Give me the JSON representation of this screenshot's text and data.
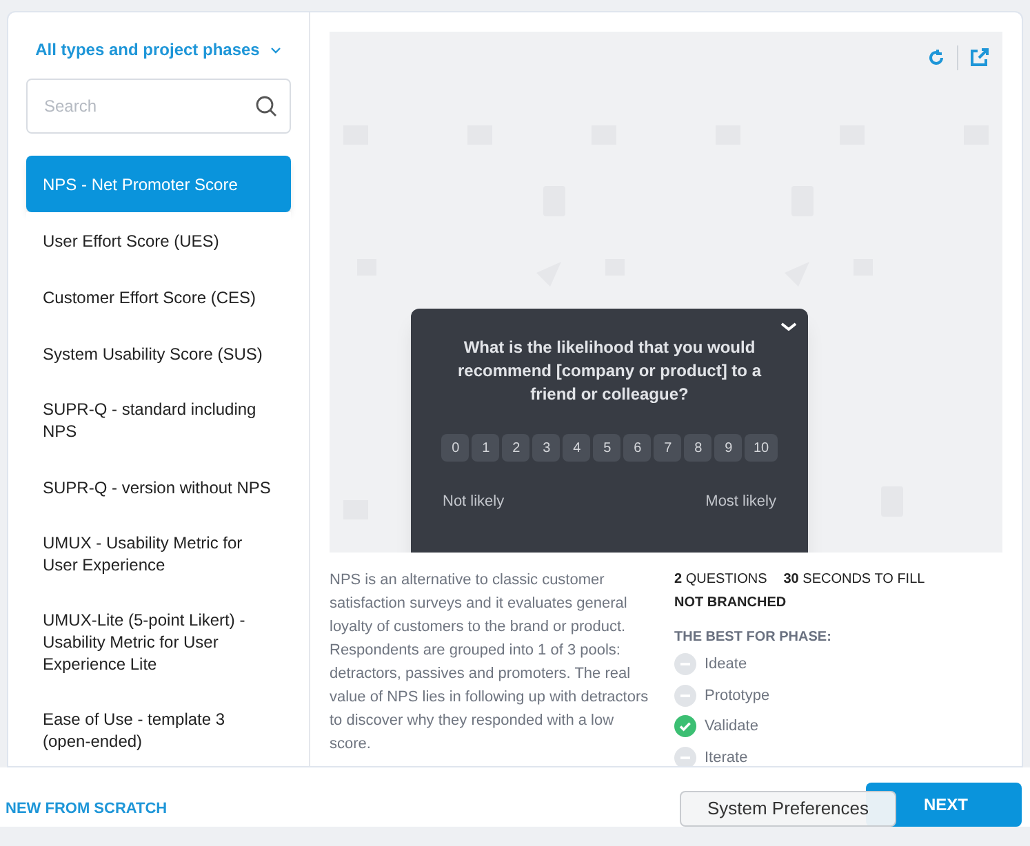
{
  "filter": {
    "label": "All types and project phases"
  },
  "search": {
    "placeholder": "Search"
  },
  "templates": [
    {
      "label": "NPS - Net Promoter Score",
      "selected": true
    },
    {
      "label": "User Effort Score (UES)",
      "selected": false
    },
    {
      "label": "Customer Effort Score (CES)",
      "selected": false
    },
    {
      "label": "System Usability Score (SUS)",
      "selected": false
    },
    {
      "label": "SUPR-Q - standard including NPS",
      "selected": false
    },
    {
      "label": "SUPR-Q - version without NPS",
      "selected": false
    },
    {
      "label": "UMUX - Usability Metric for User Experience",
      "selected": false
    },
    {
      "label": "UMUX-Lite (5-point Likert) - Usability Metric for User Experience Lite",
      "selected": false
    },
    {
      "label": "Ease of Use - template 3 (open-ended)",
      "selected": false
    }
  ],
  "survey": {
    "question": "What is the likelihood that you would recommend [company or product] to a friend or colleague?",
    "scale": [
      "0",
      "1",
      "2",
      "3",
      "4",
      "5",
      "6",
      "7",
      "8",
      "9",
      "10"
    ],
    "low_label": "Not likely",
    "high_label": "Most likely"
  },
  "description": "NPS is an alternative to classic customer satisfaction surveys and it evaluates general loyalty of customers to the brand or product. Respondents are grouped into 1 of 3 pools: detractors, passives and promoters. The real value of NPS lies in following up with detractors to discover why they responded with a low score.",
  "stats": [
    "**2** QUESTIONS",
    "**30** SECONDS TO FILL"
  ],
  "branching": "NOT BRANCHED",
  "phases_heading": "THE BEST FOR PHASE:",
  "phases": [
    {
      "label": "Ideate",
      "checked": false
    },
    {
      "label": "Prototype",
      "checked": false
    },
    {
      "label": "Validate",
      "checked": true
    },
    {
      "label": "Iterate",
      "checked": false
    }
  ],
  "footer": {
    "scratch": "NEW FROM SCRATCH",
    "next": "NEXT"
  },
  "tooltip": "System Preferences"
}
